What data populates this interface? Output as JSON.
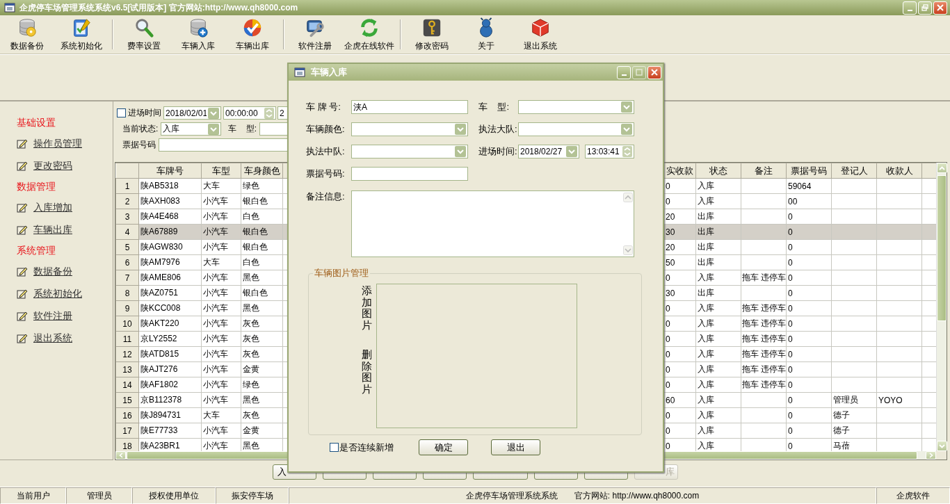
{
  "window": {
    "title": "企虎停车场管理系统系统v6.5[试用版本] 官方网站:http://www.qh8000.com"
  },
  "toolbar": {
    "groups": [
      [
        {
          "label": "数据备份"
        },
        {
          "label": "系统初始化"
        }
      ],
      [
        {
          "label": "费率设置"
        },
        {
          "label": "车辆入库"
        },
        {
          "label": "车辆出库"
        }
      ],
      [
        {
          "label": "软件注册"
        },
        {
          "label": "企虎在线软件"
        }
      ],
      [
        {
          "label": "修改密码"
        },
        {
          "label": "关于"
        },
        {
          "label": "退出系统"
        }
      ]
    ]
  },
  "sidebar": {
    "sections": [
      {
        "heading": "基础设置",
        "items": [
          {
            "label": "操作员管理"
          },
          {
            "label": "更改密码"
          }
        ]
      },
      {
        "heading": "数据管理",
        "items": [
          {
            "label": "入库增加"
          },
          {
            "label": "车辆出库"
          }
        ]
      },
      {
        "heading": "系统管理",
        "items": [
          {
            "label": "数据备份"
          },
          {
            "label": "系统初始化"
          },
          {
            "label": "软件注册"
          },
          {
            "label": "退出系统"
          }
        ]
      }
    ]
  },
  "filters": {
    "time": {
      "label": "进场时间",
      "checked": false,
      "date_from": "2018/02/01",
      "time_from": "00:00:00",
      "date_to": "2"
    },
    "status": {
      "label": "当前状态:",
      "value": "入库"
    },
    "car_type": {
      "label": "车    型:"
    },
    "ticket": {
      "label": "票据号码"
    }
  },
  "table": {
    "columns": [
      "车牌号",
      "车型",
      "车身颜色",
      "实收款",
      "状态",
      "备注",
      "票据号码",
      "登记人",
      "收款人"
    ],
    "rows": [
      {
        "number": "1",
        "selected": false,
        "cells": [
          "陕AB5318",
          "大车",
          "绿色",
          "0",
          "入库",
          null,
          "59064",
          null,
          null
        ]
      },
      {
        "number": "2",
        "selected": false,
        "cells": [
          "陕AXH083",
          "小汽车",
          "银白色",
          "0",
          "入库",
          null,
          "00",
          null,
          null
        ]
      },
      {
        "number": "3",
        "selected": false,
        "cells": [
          "陕A4E468",
          "小汽车",
          "白色",
          "20",
          "出库",
          null,
          "0",
          null,
          null
        ]
      },
      {
        "number": "4",
        "selected": true,
        "cells": [
          "陕A67889",
          "小汽车",
          "银白色",
          "30",
          "出库",
          null,
          "0",
          null,
          null
        ]
      },
      {
        "number": "5",
        "selected": false,
        "cells": [
          "陕AGW830",
          "小汽车",
          "银白色",
          "20",
          "出库",
          null,
          "0",
          null,
          null
        ]
      },
      {
        "number": "6",
        "selected": false,
        "cells": [
          "陕AM7976",
          "大车",
          "白色",
          "50",
          "出库",
          null,
          "0",
          null,
          null
        ]
      },
      {
        "number": "7",
        "selected": false,
        "cells": [
          "陕AME806",
          "小汽车",
          "黑色",
          "0",
          "入库",
          "拖车 违停车",
          "0",
          null,
          null
        ]
      },
      {
        "number": "8",
        "selected": false,
        "cells": [
          "陕AZ0751",
          "小汽车",
          "银白色",
          "30",
          "出库",
          null,
          "0",
          null,
          null
        ]
      },
      {
        "number": "9",
        "selected": false,
        "cells": [
          "陕KCC008",
          "小汽车",
          "黑色",
          "0",
          "入库",
          "拖车 违停车",
          "0",
          null,
          null
        ]
      },
      {
        "number": "10",
        "selected": false,
        "cells": [
          "陕AKT220",
          "小汽车",
          "灰色",
          "0",
          "入库",
          "拖车 违停车",
          "0",
          null,
          null
        ]
      },
      {
        "number": "11",
        "selected": false,
        "cells": [
          "京LY2552",
          "小汽车",
          "灰色",
          "0",
          "入库",
          "拖车 违停车",
          "0",
          null,
          null
        ]
      },
      {
        "number": "12",
        "selected": false,
        "cells": [
          "陕ATD815",
          "小汽车",
          "灰色",
          "0",
          "入库",
          "拖车 违停车",
          "0",
          null,
          null
        ]
      },
      {
        "number": "13",
        "selected": false,
        "cells": [
          "陕AJT276",
          "小汽车",
          "金黄",
          "0",
          "入库",
          "拖车 违停车",
          "0",
          null,
          null
        ]
      },
      {
        "number": "14",
        "selected": false,
        "cells": [
          "陕AF1802",
          "小汽车",
          "绿色",
          "0",
          "入库",
          "拖车 违停车",
          "0",
          null,
          null
        ]
      },
      {
        "number": "15",
        "selected": false,
        "cells": [
          "京B112378",
          "小汽车",
          "黑色",
          "60",
          "入库",
          null,
          "0",
          "管理员",
          "YOYO"
        ]
      },
      {
        "number": "16",
        "selected": false,
        "cells": [
          "陕J894731",
          "大车",
          "灰色",
          "0",
          "入库",
          null,
          "0",
          "德子",
          null
        ]
      },
      {
        "number": "17",
        "selected": false,
        "cells": [
          "陕E77733",
          "小汽车",
          "金黄",
          "0",
          "入库",
          null,
          "0",
          "德子",
          null
        ]
      },
      {
        "number": "18",
        "selected": false,
        "cells": [
          "陕A23BR1",
          "小汽车",
          "黑色",
          "0",
          "入库",
          null,
          "0",
          "马蓓",
          null
        ]
      }
    ]
  },
  "bottom_buttons": [
    {
      "kind": "labeled",
      "label": "入",
      "disabled": false
    },
    {
      "kind": "covered"
    },
    {
      "kind": "covered"
    },
    {
      "kind": "covered"
    },
    {
      "kind": "covered"
    },
    {
      "kind": "covered"
    },
    {
      "kind": "covered"
    },
    {
      "kind": "labeled",
      "label": "库",
      "disabled": true
    }
  ],
  "dialog": {
    "title": "车辆入库",
    "fields": [
      {
        "kind": "text",
        "label": "车 牌 号:",
        "value": "浃A"
      },
      {
        "kind": "select",
        "label": "车    型:"
      },
      {
        "kind": "select",
        "label": "车辆颜色:"
      },
      {
        "kind": "select",
        "label": "执法大队:"
      },
      {
        "kind": "select",
        "label": "执法中队:"
      },
      {
        "kind": "datetime",
        "label": "进场时间:",
        "date": "2018/02/27",
        "time": "13:03:41"
      },
      {
        "kind": "text",
        "label": "票据号码:"
      },
      {
        "kind": "textarea",
        "label": "备注信息:"
      }
    ],
    "picture_group": {
      "legend": "车辆图片管理",
      "actions": [
        "添加图片",
        "删除图片"
      ]
    },
    "continue_checkbox": {
      "label": "是否连续新增",
      "checked": false
    },
    "buttons": [
      "确定",
      "退出"
    ]
  },
  "status_bar": {
    "panels": [
      {
        "items": [
          "当前用户"
        ]
      },
      {
        "items": [
          "管理员"
        ]
      },
      {
        "items": [
          "授权使用单位"
        ]
      },
      {
        "items": [
          "振安停车场"
        ]
      },
      {
        "items": [
          "企虎停车场管理系统系统",
          "官方网站: http://www.qh8000.com"
        ]
      },
      {
        "items": [
          "企虎软件"
        ]
      }
    ]
  }
}
